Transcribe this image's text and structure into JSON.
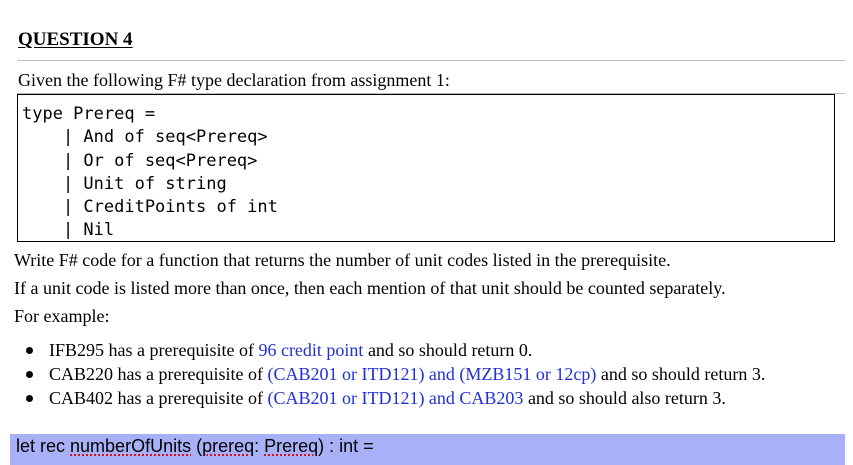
{
  "question": {
    "title": "QUESTION 4",
    "intro": "Given the following F# type declaration from assignment 1:",
    "code_lines": [
      "type Prereq =",
      "    | And of seq<Prereq>",
      "    | Or of seq<Prereq>",
      "    | Unit of string",
      "    | CreditPoints of int",
      "    | Nil"
    ],
    "instruction_1": "Write F# code for a function that returns the number of unit codes listed in the prerequisite.",
    "instruction_2": "If a unit code is listed more than once, then each mention of that unit should be counted separately.",
    "example_label": "For example:",
    "examples": [
      {
        "pre": "IFB295 has a prerequisite of ",
        "highlight": "96 credit point",
        "post": " and so should return 0."
      },
      {
        "pre": "CAB220 has a prerequisite of ",
        "highlight": "(CAB201 or ITD121) and (MZB151 or 12cp)",
        "post": " and so should return 3."
      },
      {
        "pre": "CAB402 has a prerequisite of ",
        "highlight": "(CAB201 or ITD121) and CAB203",
        "post": " and so should also return 3."
      }
    ]
  },
  "answer": {
    "prefix": "let rec ",
    "func_name": "numberOfUnits",
    "space": " (",
    "param": "prereq",
    "colon": ": ",
    "type": "Prereq",
    "suffix": ") : int ="
  },
  "colors": {
    "highlight_text": "#1f2fd6",
    "answer_bg": "#a8b1f8"
  }
}
